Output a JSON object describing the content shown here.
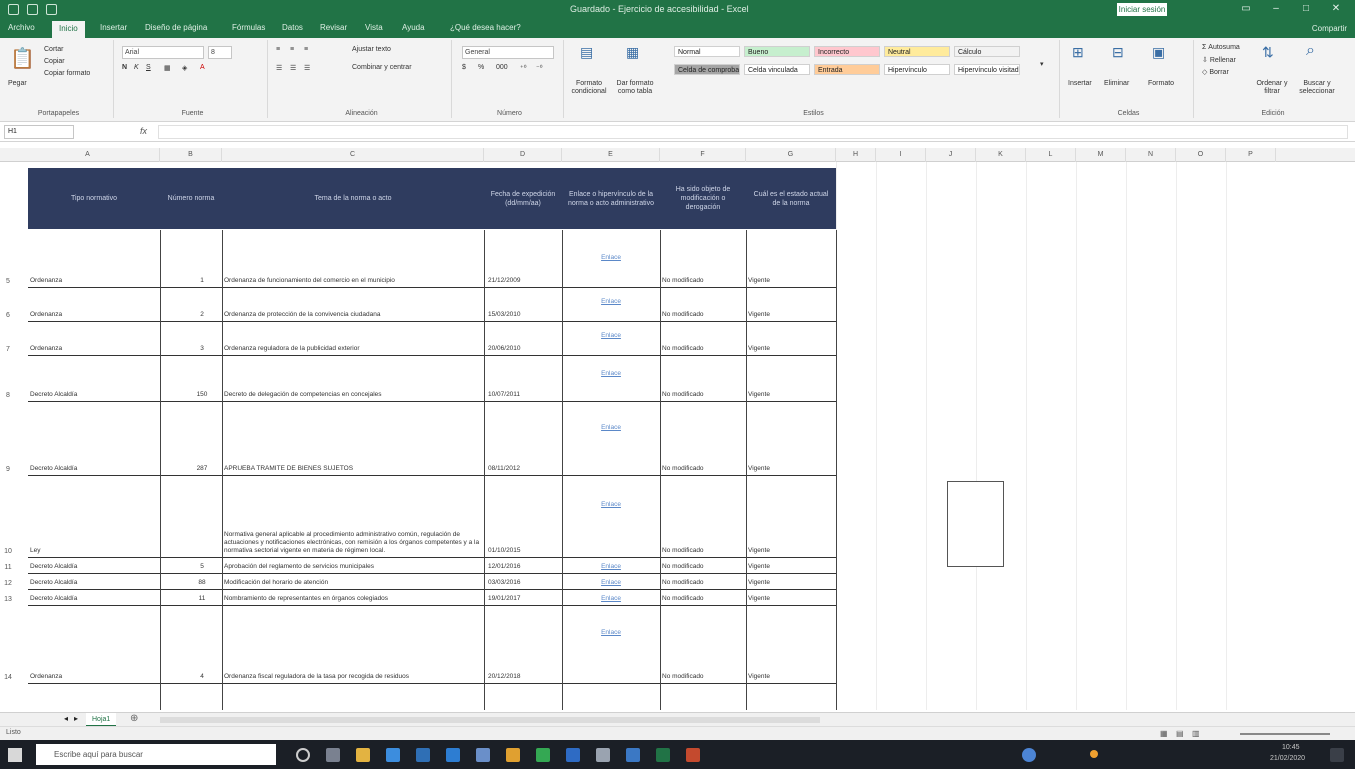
{
  "window": {
    "title": "Guardado - Ejercicio de accesibilidad - Excel",
    "signin": "Iniciar sesión"
  },
  "tabs": [
    "Archivo",
    "Inicio",
    "Insertar",
    "Diseño de página",
    "Fórmulas",
    "Datos",
    "Revisar",
    "Vista",
    "Ayuda",
    "¿Qué desea hacer?"
  ],
  "share": "Compartir",
  "ribbon": {
    "clipboard": {
      "paste": "Pegar",
      "cut": "Cortar",
      "copy": "Copiar",
      "format_painter": "Copiar formato",
      "label": "Portapapeles"
    },
    "font": {
      "name": "Arial",
      "size": "8",
      "label": "Fuente"
    },
    "alignment": {
      "wrap": "Ajustar texto",
      "merge": "Combinar y centrar",
      "label": "Alineación"
    },
    "number": {
      "format": "General",
      "label": "Número"
    },
    "styles": {
      "conditional": "Formato condicional",
      "as_table": "Dar formato como tabla",
      "chips": [
        {
          "label": "Normal",
          "bg": "#ffffff"
        },
        {
          "label": "Bueno",
          "bg": "#c6efce"
        },
        {
          "label": "Incorrecto",
          "bg": "#ffc7ce"
        },
        {
          "label": "Neutral",
          "bg": "#ffeb9c"
        },
        {
          "label": "Cálculo",
          "bg": "#f2f2f2"
        },
        {
          "label": "Celda de comprobación",
          "bg": "#a5a5a5"
        },
        {
          "label": "Celda vinculada",
          "bg": "#ffffff"
        },
        {
          "label": "Entrada",
          "bg": "#ffcc99"
        },
        {
          "label": "Hipervínculo",
          "bg": "#ffffff"
        },
        {
          "label": "Hipervínculo visitado",
          "bg": "#ffffff"
        }
      ],
      "label": "Estilos"
    },
    "cells": {
      "insert": "Insertar",
      "delete": "Eliminar",
      "format": "Formato",
      "label": "Celdas"
    },
    "editing": {
      "autosum": "Autosuma",
      "fill": "Rellenar",
      "clear": "Borrar",
      "sort": "Ordenar y filtrar",
      "find": "Buscar y seleccionar",
      "label": "Edición"
    }
  },
  "formula_bar": {
    "name_box": "H1",
    "fx": "fx"
  },
  "columns": [
    "A",
    "B",
    "C",
    "D",
    "E",
    "F",
    "G",
    "H",
    "I",
    "J",
    "K",
    "L",
    "M",
    "N",
    "O",
    "P"
  ],
  "table": {
    "headers": [
      "Tipo normativo",
      "Número norma",
      "Tema de la norma o acto",
      "Fecha de expedición (dd/mm/aa)",
      "Enlace o hipervínculo de la norma o acto administrativo",
      "Ha sido objeto de modificación o derogación",
      "Cuál es el estado actual de la norma"
    ],
    "rows": [
      {
        "num": "5",
        "tipo": "Ordenanza",
        "numero": "1",
        "tema": "Ordenanza de funcionamiento del comercio en el municipio",
        "fecha": "21/12/2009",
        "enlace": "Enlace",
        "modificado": "No modificado",
        "estado": "Vigente"
      },
      {
        "num": "6",
        "tipo": "Ordenanza",
        "numero": "2",
        "tema": "Ordenanza de protección de la convivencia ciudadana",
        "fecha": "15/03/2010",
        "enlace": "Enlace",
        "modificado": "No modificado",
        "estado": "Vigente"
      },
      {
        "num": "7",
        "tipo": "Ordenanza",
        "numero": "3",
        "tema": "Ordenanza reguladora de la publicidad exterior",
        "fecha": "20/06/2010",
        "enlace": "Enlace",
        "modificado": "No modificado",
        "estado": "Vigente"
      },
      {
        "num": "8",
        "tipo": "Decreto Alcaldía",
        "numero": "150",
        "tema": "Decreto de delegación de competencias en concejales",
        "fecha": "10/07/2011",
        "enlace": "Enlace",
        "modificado": "No modificado",
        "estado": "Vigente"
      },
      {
        "num": "9",
        "tipo": "Decreto Alcaldía",
        "numero": "287",
        "tema": "APRUEBA TRÁMITE DE BIENES SUJETOS",
        "fecha": "08/11/2012",
        "enlace": "Enlace",
        "modificado": "No modificado",
        "estado": "Vigente"
      },
      {
        "num": "10",
        "tipo": "Ley",
        "numero": "",
        "tema": "Normativa general aplicable al procedimiento administrativo común, regulación de actuaciones y notificaciones electrónicas, con remisión a los órganos competentes y a la normativa sectorial vigente en materia de régimen local.",
        "fecha": "01/10/2015",
        "enlace": "Enlace",
        "modificado": "No modificado",
        "estado": "Vigente"
      },
      {
        "num": "11",
        "tipo": "Decreto Alcaldía",
        "numero": "5",
        "tema": "Aprobación del reglamento de servicios municipales",
        "fecha": "12/01/2016",
        "enlace": "Enlace",
        "modificado": "No modificado",
        "estado": "Vigente"
      },
      {
        "num": "12",
        "tipo": "Decreto Alcaldía",
        "numero": "88",
        "tema": "Modificación del horario de atención",
        "fecha": "03/03/2016",
        "enlace": "Enlace",
        "modificado": "No modificado",
        "estado": "Vigente"
      },
      {
        "num": "13",
        "tipo": "Decreto Alcaldía",
        "numero": "11",
        "tema": "Nombramiento de representantes en órganos colegiados",
        "fecha": "19/01/2017",
        "enlace": "Enlace",
        "modificado": "No modificado",
        "estado": "Vigente"
      },
      {
        "num": "14",
        "tipo": "Ordenanza",
        "numero": "4",
        "tema": "Ordenanza fiscal reguladora de la tasa por recogida de residuos",
        "fecha": "20/12/2018",
        "enlace": "Enlace",
        "modificado": "No modificado",
        "estado": "Vigente"
      }
    ]
  },
  "sheet_tab": "Hoja1",
  "status": "Listo",
  "taskbar": {
    "search_placeholder": "Escribe aquí para buscar",
    "time": "10:45",
    "date": "21/02/2020"
  }
}
